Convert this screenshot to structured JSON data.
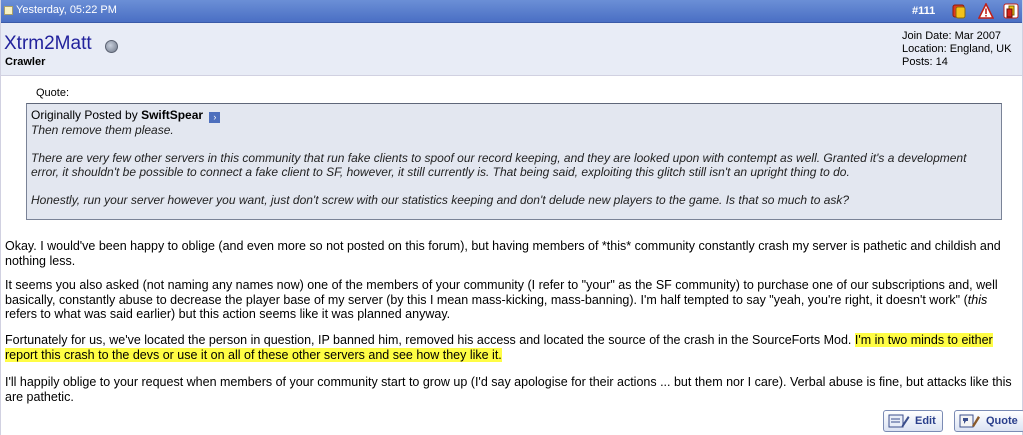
{
  "post": {
    "date": "Yesterday, 05:22 PM",
    "number": "#111"
  },
  "user": {
    "name": "Xtrm2Matt",
    "title": "Crawler",
    "join_date": "Join Date: Mar 2007",
    "location": "Location: England, UK",
    "posts": "Posts: 14"
  },
  "quote": {
    "label": "Quote:",
    "originally_posted_by": "Originally Posted by",
    "author": "SwiftSpear",
    "lines": [
      "Then remove them please.",
      "There are very few other servers in this community that run fake clients to spoof our record keeping, and they are looked upon with contempt as well. Granted it's a development error, it shouldn't be possible to connect a fake client to SF, however, it still currently is. That being said, exploiting this glitch still isn't an upright thing to do.",
      "Honestly, run your server however you want, just don't screw with our statistics keeping and don't delude new players to the game. Is that so much to ask?"
    ]
  },
  "message": {
    "p1": "Okay. I would've been happy to oblige (and even more so not posted on this forum), but having members of *this* community constantly crash my server is pathetic and childish and nothing less.",
    "p2_before": "It seems you also asked (not naming any names now) one of the members of your community (I refer to \"your\" as the SF community) to purchase one of our subscriptions and, well basically, constantly abuse to decrease the player base of my server (by this I mean mass-kicking, mass-banning). I'm half tempted to say \"yeah, you're right, it doesn't work\" (",
    "p2_italic": "this",
    "p2_after": " refers to what was said earlier) but this action seems like it was planned anyway.",
    "p3_plain": "Fortunately for us, we've located the person in question, IP banned him, removed his access and located the source of the crash in the SourceForts Mod. ",
    "p3_highlight": "I'm in two minds to either report this crash to the devs or use it on all of these other servers and see how they like it.",
    "p4": "I'll happily oblige to your request when members of your community start to grow up (I'd say apologise for their actions ... but them nor I care). Verbal abuse is fine, but attacks like this are pathetic."
  },
  "buttons": {
    "edit": "Edit",
    "quote": "Quote"
  },
  "icons": [
    "post-icon",
    "reputation-icon",
    "report-icon",
    "warn-icon",
    "online-status-icon",
    "view-post-icon",
    "edit-icon",
    "quote-icon"
  ],
  "colors": {
    "header": "#4a6fc4",
    "username": "#22229c",
    "highlight": "#fffd45",
    "quote_bg": "#e3e7f0"
  }
}
